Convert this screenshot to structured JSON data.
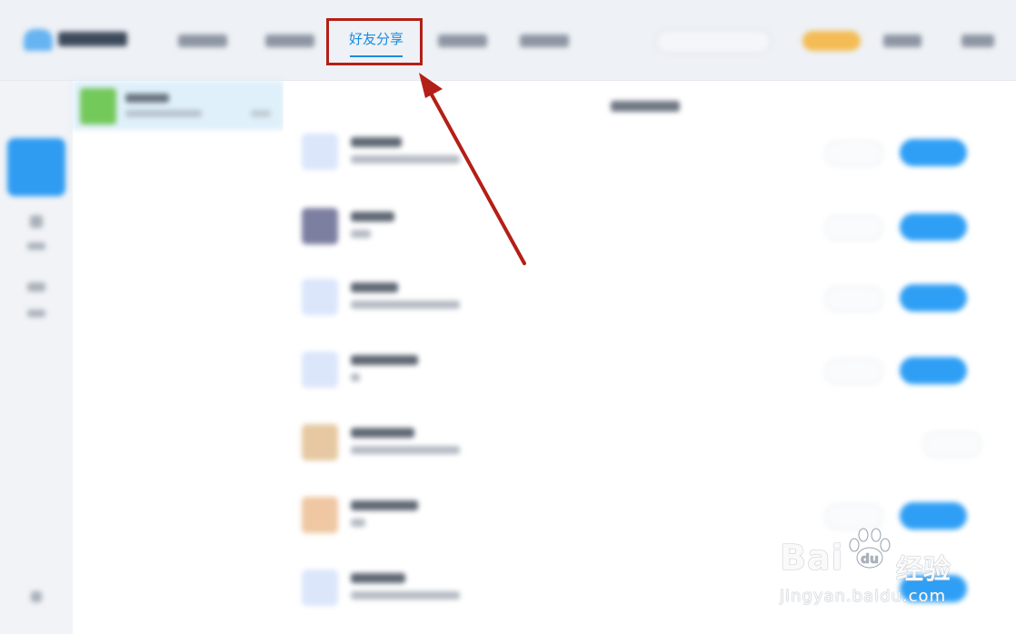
{
  "header": {
    "active_tab_label": "好友分享"
  },
  "watermark": {
    "brand": "Bai",
    "brand_tail": "du",
    "cn": "经验",
    "url": "jingyan.baidu.com"
  },
  "colors": {
    "accent": "#1a8be0",
    "callout": "#b41f17",
    "primary_button": "#2f9ff5",
    "vip": "#f4bc55"
  },
  "icons": [
    "cloud-logo-icon",
    "paw-icon",
    "arrow-pointer-icon"
  ]
}
